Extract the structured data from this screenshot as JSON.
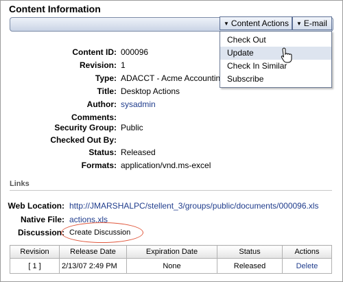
{
  "section_title": "Content Information",
  "toolbar": {
    "content_actions_label": "Content Actions",
    "email_label": "E-mail"
  },
  "menu": {
    "items": [
      {
        "label": "Check Out"
      },
      {
        "label": "Update"
      },
      {
        "label": "Check In Similar"
      },
      {
        "label": "Subscribe"
      }
    ],
    "hovered_index": 1
  },
  "details": [
    {
      "label": "Content ID:",
      "value": "000096"
    },
    {
      "label": "Revision:",
      "value": "1"
    },
    {
      "label": "Type:",
      "value": "ADACCT - Acme Accountin"
    },
    {
      "label": "Title:",
      "value": "Desktop Actions"
    },
    {
      "label": "Author:",
      "value": "sysadmin"
    },
    {
      "label": "Comments:",
      "value": ""
    },
    {
      "label": "Security Group:",
      "value": "Public"
    },
    {
      "label": "Checked Out By:",
      "value": ""
    },
    {
      "label": "Status:",
      "value": "Released"
    },
    {
      "label": "Formats:",
      "value": "application/vnd.ms-excel"
    }
  ],
  "links_section": {
    "heading": "Links",
    "web_location_label": "Web Location:",
    "web_location_value": "http://JMARSHALPC/stellent_3/groups/public/documents/000096.xls",
    "native_file_label": "Native File:",
    "native_file_value": "actions.xls",
    "discussion_label": "Discussion:",
    "discussion_value": "Create Discussion"
  },
  "revisions_table": {
    "headers": [
      "Revision",
      "Release Date",
      "Expiration Date",
      "Status",
      "Actions"
    ],
    "rows": [
      {
        "revision": "[ 1 ]",
        "release_date": "2/13/07 2:49 PM",
        "expiration_date": "None",
        "status": "Released",
        "action": "Delete"
      }
    ]
  },
  "colors": {
    "link": "#1f3c8c",
    "highlight_ellipse": "#e0573c",
    "menu_hover": "#dde4ef"
  }
}
